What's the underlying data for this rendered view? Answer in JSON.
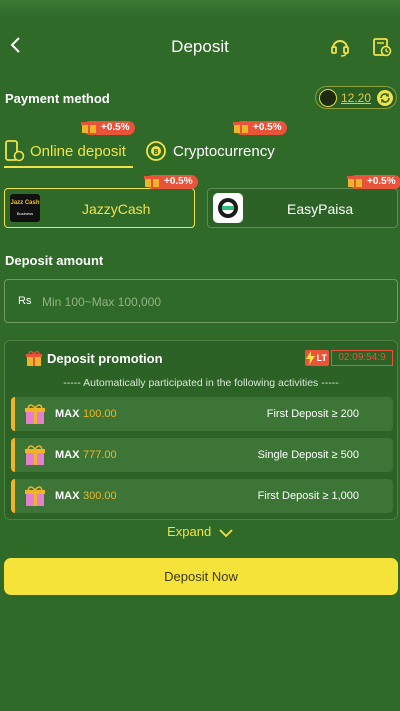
{
  "header": {
    "title": "Deposit",
    "icons": [
      "back-icon",
      "headset-icon",
      "history-icon"
    ]
  },
  "payment_method": {
    "label": "Payment method",
    "balance": "12.20"
  },
  "tabs": [
    {
      "label": "Online deposit",
      "badge": "+0.5%",
      "active": true
    },
    {
      "label": "Cryptocurrency",
      "badge": "+0.5%",
      "active": false
    }
  ],
  "methods": [
    {
      "label": "JazzyCash",
      "badge": "+0.5%",
      "logo_text": "Jazz Cash",
      "logo_sub": "Business",
      "selected": true
    },
    {
      "label": "EasyPaisa",
      "badge": "+0.5%",
      "selected": false
    }
  ],
  "deposit_amount": {
    "label": "Deposit amount",
    "currency": "Rs",
    "placeholder": "Min 100~Max 100,000"
  },
  "promotion": {
    "title": "Deposit promotion",
    "lt_label": "LT",
    "timer": "02:09:54:9",
    "subtitle": "----- Automatically participated in the following activities -----",
    "rows": [
      {
        "max_label": "MAX",
        "max_value": "100.00",
        "condition": "First Deposit ≥ 200"
      },
      {
        "max_label": "MAX",
        "max_value": "777.00",
        "condition": "Single Deposit ≥ 500"
      },
      {
        "max_label": "MAX",
        "max_value": "300.00",
        "condition": "First Deposit ≥ 1,000"
      }
    ],
    "expand_label": "Expand"
  },
  "cta": {
    "label": "Deposit Now"
  },
  "colors": {
    "background": "#2f6a29",
    "accent_yellow": "#f2e24a",
    "badge_red": "#e8533a",
    "amount_orange": "#f0b42a"
  }
}
